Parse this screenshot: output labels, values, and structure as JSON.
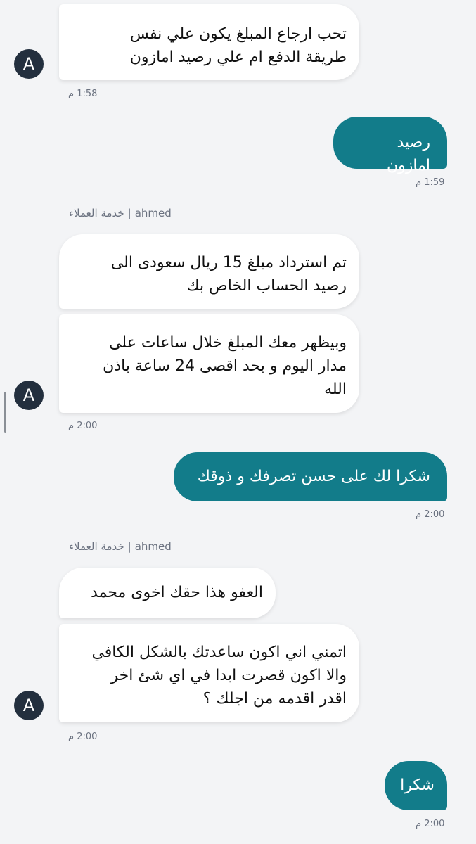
{
  "messages": [
    {
      "id": "m1",
      "from": "agent",
      "lines": "تحب ارجاع المبلغ يكون علي نفس\nطريقة الدفع ام علي رصيد امازون",
      "time": "1:58 م"
    },
    {
      "id": "m2",
      "from": "user",
      "lines": "رصيد امازون",
      "time": "1:59 م"
    },
    {
      "id": "g3",
      "from": "agent",
      "sender_name": "ahmed",
      "sender_team": "خدمة العملاء",
      "bubbles": [
        "تم استرداد مبلغ 15 ريال سعودى الى\nرصيد الحساب الخاص بك",
        "وبيظهر معك المبلغ خلال ساعات على\nمدار اليوم و بحد اقصى 24 ساعة باذن\nالله"
      ],
      "time": "2:00 م"
    },
    {
      "id": "m4",
      "from": "user",
      "lines": "شكرا لك على حسن تصرفك و ذوقك",
      "time": "2:00 م"
    },
    {
      "id": "g5",
      "from": "agent",
      "sender_name": "ahmed",
      "sender_team": "خدمة العملاء",
      "bubbles": [
        "العفو هذا حقك اخوى محمد",
        "اتمني اني اكون ساعدتك بالشكل الكافي\nوالا اكون قصرت ابدا في اي شئ اخر\nاقدر اقدمه من اجلك ؟"
      ],
      "time": "2:00 م"
    },
    {
      "id": "m6",
      "from": "user",
      "lines": "شكرا",
      "time": "2:00 م"
    }
  ],
  "avatar": {
    "letter": "A",
    "color": "#232f3e"
  },
  "colors": {
    "user_bubble": "#127c8a",
    "agent_bubble": "#ffffff",
    "background": "#f3f4f6"
  },
  "sender_separator": "|"
}
